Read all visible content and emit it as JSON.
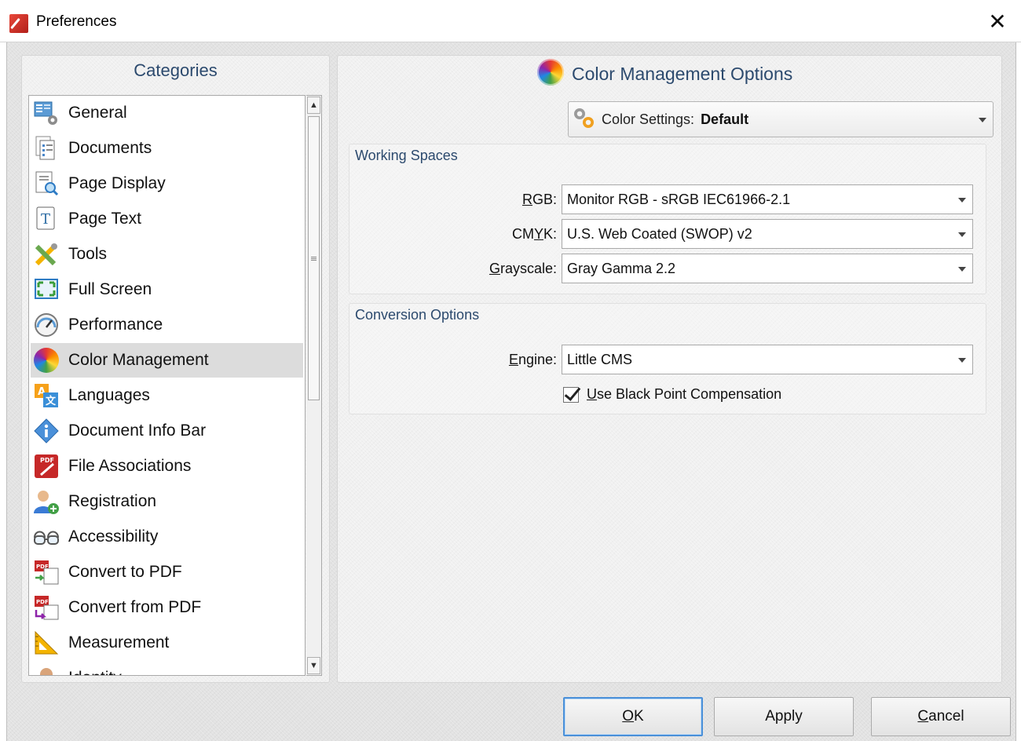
{
  "window": {
    "title": "Preferences",
    "close_glyph": "✕"
  },
  "categories": {
    "title": "Categories",
    "selected": "Color Management",
    "items": [
      {
        "label": "General",
        "icon": "general-icon"
      },
      {
        "label": "Documents",
        "icon": "documents-icon"
      },
      {
        "label": "Page Display",
        "icon": "page-display-icon"
      },
      {
        "label": "Page Text",
        "icon": "page-text-icon"
      },
      {
        "label": "Tools",
        "icon": "tools-icon"
      },
      {
        "label": "Full Screen",
        "icon": "full-screen-icon"
      },
      {
        "label": "Performance",
        "icon": "performance-icon"
      },
      {
        "label": "Color Management",
        "icon": "color-wheel-icon"
      },
      {
        "label": "Languages",
        "icon": "languages-icon"
      },
      {
        "label": "Document Info Bar",
        "icon": "info-icon"
      },
      {
        "label": "File Associations",
        "icon": "pdf-file-icon"
      },
      {
        "label": "Registration",
        "icon": "registration-icon"
      },
      {
        "label": "Accessibility",
        "icon": "glasses-icon"
      },
      {
        "label": "Convert to PDF",
        "icon": "convert-to-pdf-icon"
      },
      {
        "label": "Convert from PDF",
        "icon": "convert-from-pdf-icon"
      },
      {
        "label": "Measurement",
        "icon": "ruler-icon"
      },
      {
        "label": "Identity",
        "icon": "identity-icon"
      }
    ]
  },
  "options": {
    "title": "Color Management Options",
    "color_settings": {
      "label": "Color Settings:",
      "value": "Default"
    },
    "working_spaces": {
      "title": "Working Spaces",
      "rgb": {
        "label_u": "R",
        "label_rest": "GB:",
        "value": "Monitor RGB - sRGB IEC61966-2.1"
      },
      "cmyk": {
        "label_a": "CM",
        "label_u": "Y",
        "label_rest": "K:",
        "value": "U.S. Web Coated (SWOP) v2"
      },
      "gray": {
        "label_u": "G",
        "label_rest": "rayscale:",
        "value": "Gray Gamma 2.2"
      }
    },
    "conversion": {
      "title": "Conversion Options",
      "engine": {
        "label_u": "E",
        "label_rest": "ngine:",
        "value": "Little CMS"
      },
      "bpc": {
        "label_u": "U",
        "label_rest": "se Black Point Compensation",
        "checked": true
      }
    }
  },
  "buttons": {
    "ok": {
      "u": "O",
      "rest": "K"
    },
    "apply": {
      "label": "Apply"
    },
    "cancel": {
      "u": "C",
      "rest": "ancel"
    }
  },
  "colors": {
    "accent_blue": "#2c4a6e",
    "selection": "#dcdcdc",
    "default_button_border": "#4a90d9"
  }
}
